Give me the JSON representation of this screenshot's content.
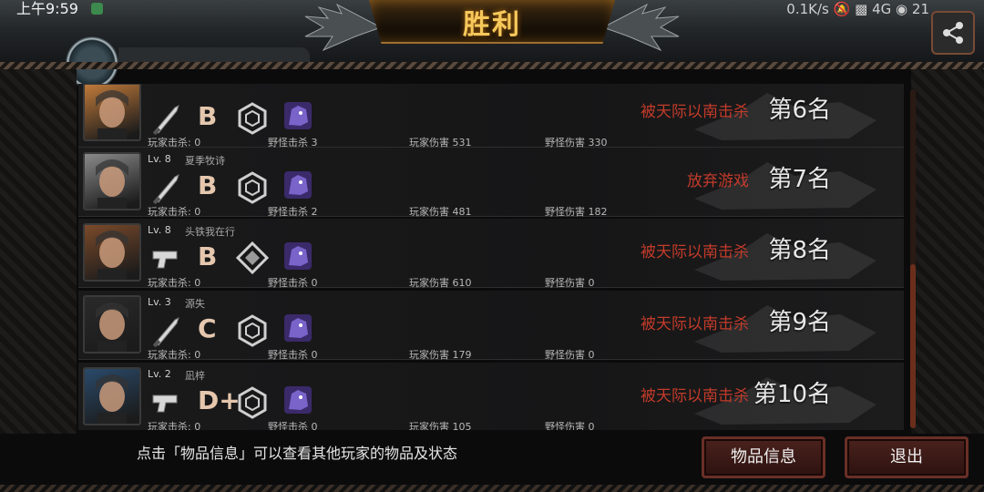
{
  "status": {
    "time": "上午9:59",
    "network": "0.1K/s",
    "signal": "4G",
    "battery": "21"
  },
  "header": {
    "title": "胜利"
  },
  "rows": [
    {
      "level": "",
      "name": "",
      "weapon": "knife-icon",
      "grade": "B",
      "badge": "hexagon-badge-icon",
      "player_kills": "玩家击杀: 0",
      "monster_kills": "野怪击杀 3",
      "player_damage": "玩家伤害 531",
      "monster_damage": "野怪伤害 330",
      "cause": "被天际以南击杀",
      "rank": "第6名",
      "portrait_color": "#c07a3a"
    },
    {
      "level": "Lv. 8",
      "name": "夏季牧诗",
      "weapon": "knife-icon",
      "grade": "B",
      "badge": "hexagon-badge-icon",
      "player_kills": "玩家击杀: 0",
      "monster_kills": "野怪击杀 2",
      "player_damage": "玩家伤害 481",
      "monster_damage": "野怪伤害 182",
      "cause": "放弃游戏",
      "rank": "第7名",
      "portrait_color": "#8a8a8a"
    },
    {
      "level": "Lv. 8",
      "name": "头铁我在行",
      "weapon": "pistol-icon",
      "grade": "B",
      "badge": "diamond-badge-icon",
      "player_kills": "玩家击杀: 0",
      "monster_kills": "野怪击杀 0",
      "player_damage": "玩家伤害 610",
      "monster_damage": "野怪伤害 0",
      "cause": "被天际以南击杀",
      "rank": "第8名",
      "portrait_color": "#7a4a2a"
    },
    {
      "level": "Lv. 3",
      "name": "源失",
      "weapon": "knife-icon",
      "grade": "C",
      "badge": "hexagon-badge-icon",
      "player_kills": "玩家击杀: 0",
      "monster_kills": "野怪击杀 0",
      "player_damage": "玩家伤害 179",
      "monster_damage": "野怪伤害 0",
      "cause": "被天际以南击杀",
      "rank": "第9名",
      "portrait_color": "#2a2a2a"
    },
    {
      "level": "Lv. 2",
      "name": "凪梓",
      "weapon": "pistol-icon",
      "grade": "D+",
      "badge": "hexagon-badge-icon",
      "player_kills": "玩家击杀: 0",
      "monster_kills": "野怪击杀 0",
      "player_damage": "玩家伤害 105",
      "monster_damage": "野怪伤害 0",
      "cause": "被天际以南击杀",
      "rank": "第10名",
      "portrait_color": "#2a4a6a"
    }
  ],
  "footer": {
    "hint": "点击「物品信息」可以查看其他玩家的物品及状态",
    "items_button": "物品信息",
    "exit_button": "退出"
  },
  "colors": {
    "accent": "#f6c85b",
    "cause": "#c23b2a",
    "button": "#4a221d"
  }
}
